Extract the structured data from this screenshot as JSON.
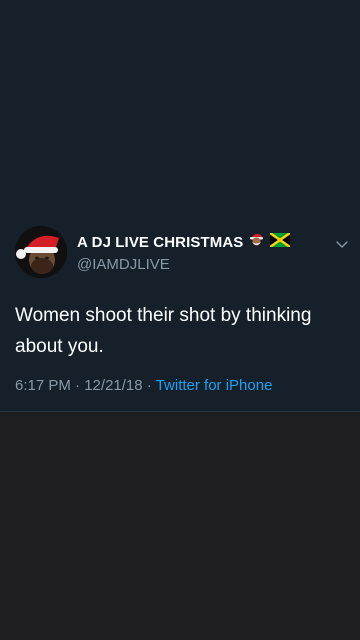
{
  "user": {
    "display_name": "A DJ LIVE CHRISTMAS",
    "handle": "@IAMDJLIVE",
    "name_emojis": [
      "santa-emoji",
      "jamaica-flag-emoji"
    ]
  },
  "tweet": {
    "text": "Women shoot their shot by thinking about you.",
    "time": "6:17 PM",
    "date": "12/21/18",
    "separator": "·",
    "source": "Twitter for iPhone"
  },
  "colors": {
    "background": "#15202b",
    "text_primary": "#ffffff",
    "text_secondary": "#8899a6",
    "link": "#1da1f2"
  },
  "icons": {
    "menu": "chevron-down-icon"
  }
}
